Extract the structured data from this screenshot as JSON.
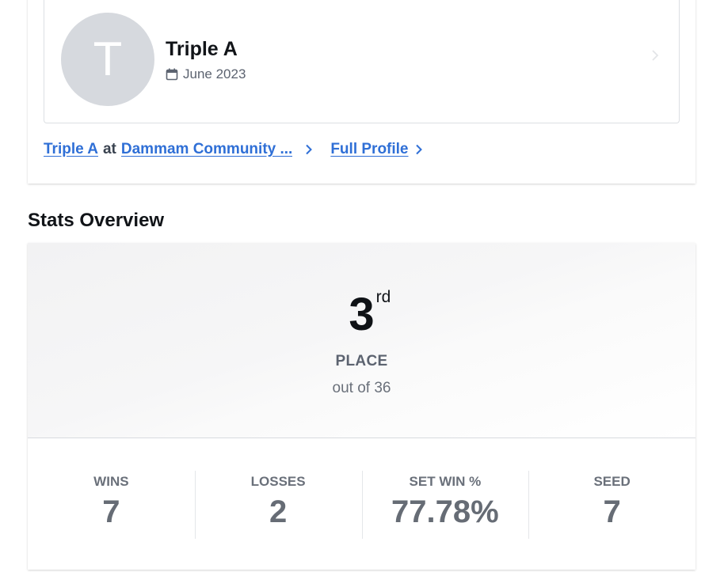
{
  "player": {
    "avatar_letter": "T",
    "name": "Triple A",
    "joined": "June 2023"
  },
  "links": {
    "team_name": "Triple A",
    "at_word": "at",
    "community": "Dammam Community ...",
    "full_profile": "Full Profile"
  },
  "stats": {
    "section_title": "Stats Overview",
    "place": {
      "rank": "3",
      "suffix": "rd",
      "label": "PLACE",
      "out_of": "out of 36"
    },
    "items": [
      {
        "label": "WINS",
        "value": "7"
      },
      {
        "label": "LOSSES",
        "value": "2"
      },
      {
        "label": "SET WIN %",
        "value": "77.78%"
      },
      {
        "label": "SEED",
        "value": "7"
      }
    ]
  },
  "icons": {
    "date": "calendar-icon",
    "row_chevron": "chevron-right-icon",
    "link_chevron": "chevron-right-icon"
  },
  "colors": {
    "link": "#2f6fd6",
    "avatar_bg": "#d6d9de",
    "stat_value": "#666c75"
  }
}
